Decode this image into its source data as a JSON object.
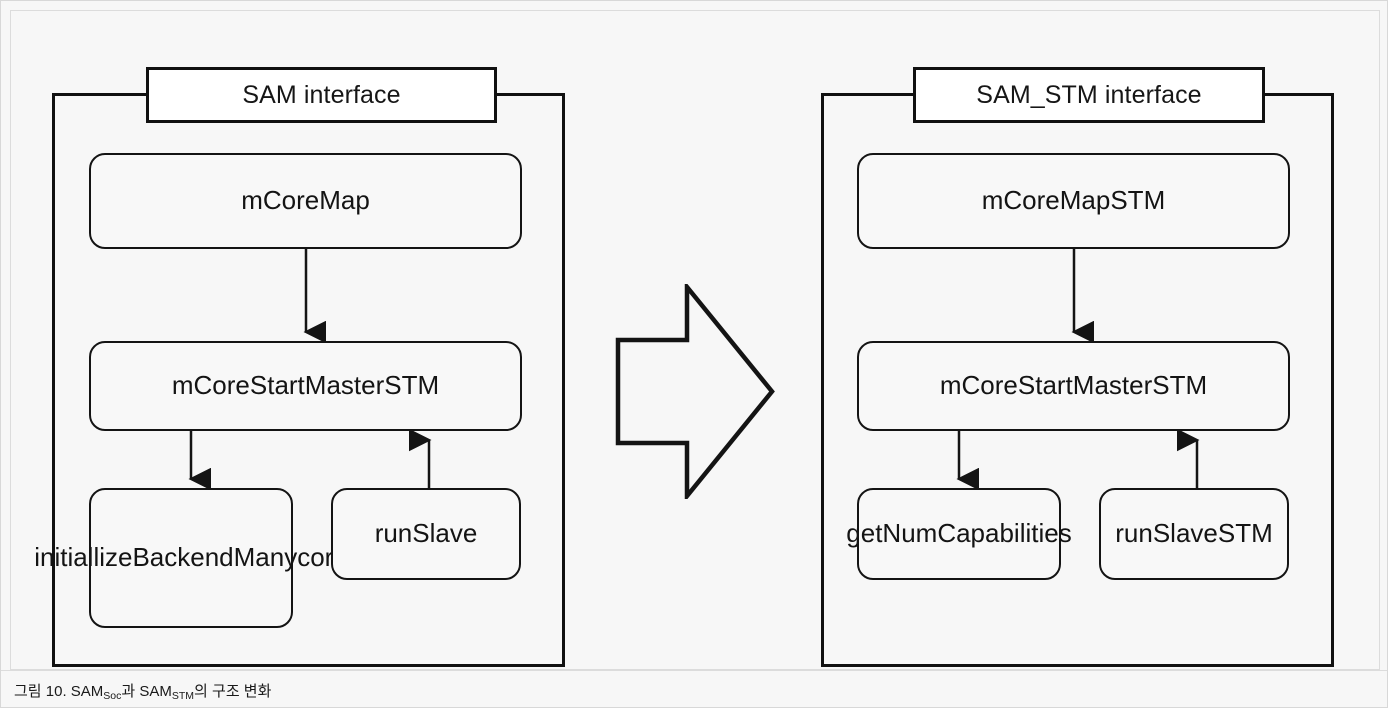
{
  "figure": {
    "caption_prefix": "그림 10. SAM",
    "caption_sub1": "Soc",
    "caption_mid": "과 SAM",
    "caption_sub2": "STM",
    "caption_suffix": "의 구조 변화",
    "background_color": "#f7f7f7",
    "line_color": "#111111"
  },
  "left_package": {
    "header_label": "SAM interface",
    "nodes": {
      "top": "mCoreMap",
      "middle": "mCoreStartMasterSTM",
      "bottom_left": "initiallizeBackendManycore",
      "bottom_right": "runSlave"
    }
  },
  "right_package": {
    "header_label": "SAM_STM interface",
    "nodes": {
      "top": "mCoreMapSTM",
      "middle": "mCoreStartMasterSTM",
      "bottom_left": "getNumCapabilities",
      "bottom_right": "runSlaveSTM"
    }
  },
  "transform": {
    "icon": "block-arrow-right-icon"
  },
  "chart_data": {
    "type": "diagram",
    "title": "SAM_Soc 과 SAM_STM 의 구조 변화",
    "panels": [
      {
        "name": "SAM interface",
        "nodes": [
          "mCoreMap",
          "mCoreStartMasterSTM",
          "initiallizeBackendManycore",
          "runSlave"
        ],
        "edges": [
          {
            "from": "mCoreMap",
            "to": "mCoreStartMasterSTM",
            "direction": "down"
          },
          {
            "from": "mCoreStartMasterSTM",
            "to": "initiallizeBackendManycore",
            "direction": "down"
          },
          {
            "from": "runSlave",
            "to": "mCoreStartMasterSTM",
            "direction": "up"
          }
        ]
      },
      {
        "name": "SAM_STM interface",
        "nodes": [
          "mCoreMapSTM",
          "mCoreStartMasterSTM",
          "getNumCapabilities",
          "runSlaveSTM"
        ],
        "edges": [
          {
            "from": "mCoreMapSTM",
            "to": "mCoreStartMasterSTM",
            "direction": "down"
          },
          {
            "from": "mCoreStartMasterSTM",
            "to": "getNumCapabilities",
            "direction": "down"
          },
          {
            "from": "runSlaveSTM",
            "to": "mCoreStartMasterSTM",
            "direction": "up"
          }
        ]
      }
    ]
  }
}
